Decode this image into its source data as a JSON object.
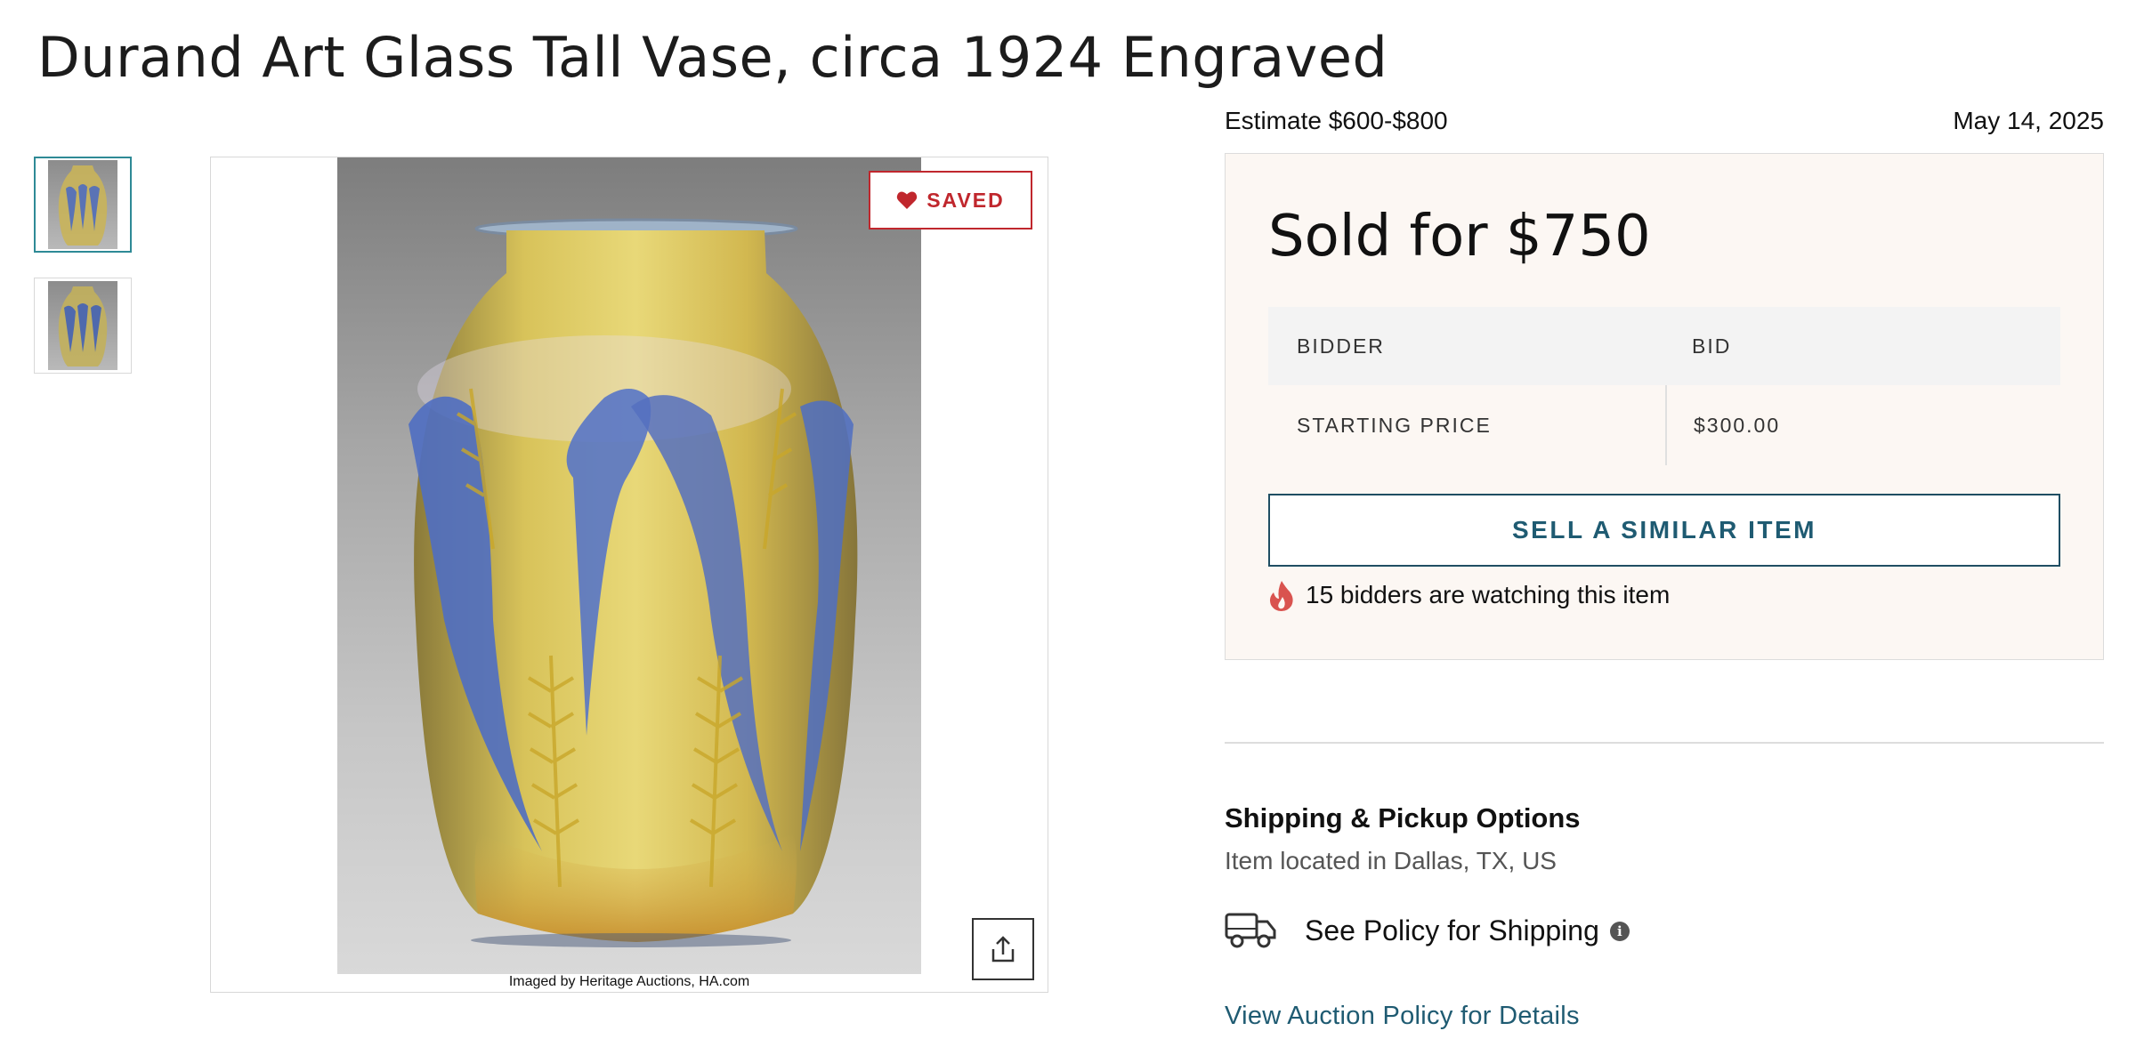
{
  "listing": {
    "title": "Durand Art Glass Tall Vase, circa 1924 Engraved",
    "estimate": "Estimate $600-$800",
    "date": "May 14, 2025"
  },
  "gallery": {
    "thumbnails": [
      "vase-front",
      "vase-alt"
    ],
    "active_index": 0,
    "saved_label": "SAVED",
    "image_credit": "Imaged by Heritage Auctions, HA.com"
  },
  "sale": {
    "sold_text": "Sold for $750",
    "table": {
      "headers": [
        "BIDDER",
        "BID"
      ],
      "rows": [
        [
          "STARTING PRICE",
          "$300.00"
        ]
      ]
    },
    "sell_button": "SELL A SIMILAR ITEM",
    "watching_text": "15 bidders are watching this item"
  },
  "shipping": {
    "title": "Shipping & Pickup Options",
    "location": "Item located in Dallas, TX, US",
    "policy_label": "See Policy for Shipping",
    "auction_link": "View Auction Policy for Details"
  },
  "colors": {
    "saved_red": "#c0272d",
    "link_teal": "#1f5b72",
    "panel_bg": "#fcf7f3"
  }
}
